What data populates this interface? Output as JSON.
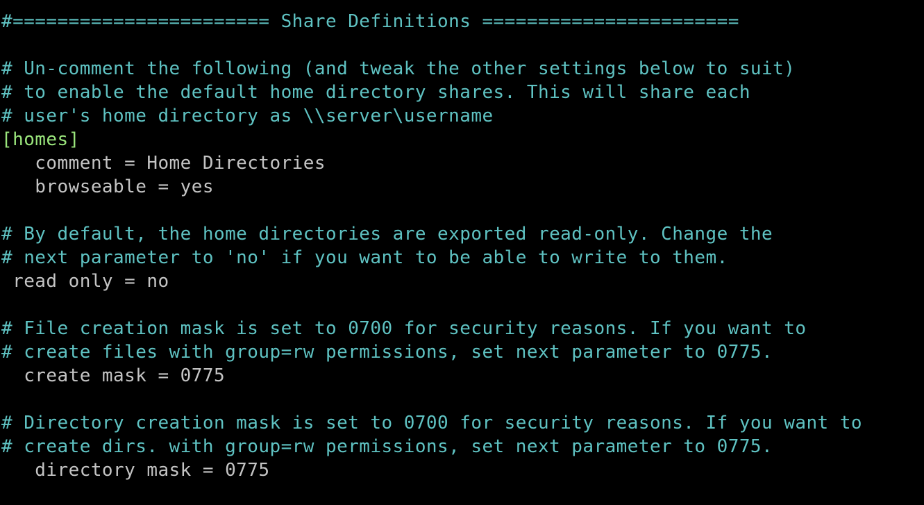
{
  "colors": {
    "background": "#000000",
    "comment": "#5fc2c2",
    "section": "#9ae57c",
    "setting": "#c4c4c4"
  },
  "editor": {
    "lines": [
      {
        "kind": "comment",
        "text": "#======================= Share Definitions ======================="
      },
      {
        "kind": "blank",
        "text": ""
      },
      {
        "kind": "comment",
        "text": "# Un-comment the following (and tweak the other settings below to suit)"
      },
      {
        "kind": "comment",
        "text": "# to enable the default home directory shares. This will share each"
      },
      {
        "kind": "comment",
        "text": "# user's home directory as \\\\server\\username"
      },
      {
        "kind": "section",
        "text": "[homes]"
      },
      {
        "kind": "setting",
        "text": "   comment = Home Directories"
      },
      {
        "kind": "setting",
        "text": "   browseable = yes"
      },
      {
        "kind": "blank",
        "text": ""
      },
      {
        "kind": "comment",
        "text": "# By default, the home directories are exported read-only. Change the"
      },
      {
        "kind": "comment",
        "text": "# next parameter to 'no' if you want to be able to write to them."
      },
      {
        "kind": "setting",
        "text": " read only = no"
      },
      {
        "kind": "blank",
        "text": ""
      },
      {
        "kind": "comment",
        "text": "# File creation mask is set to 0700 for security reasons. If you want to"
      },
      {
        "kind": "comment",
        "text": "# create files with group=rw permissions, set next parameter to 0775."
      },
      {
        "kind": "setting",
        "text": "  create mask = 0775"
      },
      {
        "kind": "blank",
        "text": ""
      },
      {
        "kind": "comment",
        "text": "# Directory creation mask is set to 0700 for security reasons. If you want to"
      },
      {
        "kind": "comment",
        "text": "# create dirs. with group=rw permissions, set next parameter to 0775."
      },
      {
        "kind": "setting",
        "text": "   directory mask = 0775"
      }
    ]
  }
}
